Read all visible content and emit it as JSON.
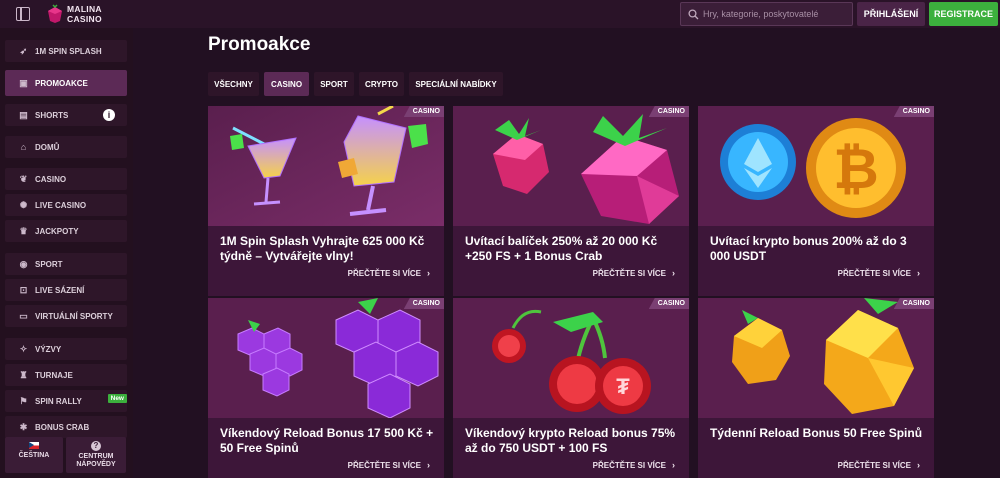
{
  "header": {
    "logo_line1": "MALINA",
    "logo_line2": "CASINO",
    "search_placeholder": "Hry, kategorie, poskytovatelé",
    "login_label": "PŘIHLÁŠENÍ",
    "register_label": "REGISTRACE"
  },
  "sidebar": {
    "items": [
      {
        "label": "1M SPIN SPLASH",
        "icon": "rocket-icon"
      },
      {
        "label": "PROMOAKCE",
        "icon": "gift-icon"
      },
      {
        "label": "SHORTS",
        "icon": "film-icon"
      },
      {
        "label": "DOMŮ",
        "icon": "home-icon"
      },
      {
        "label": "CASINO",
        "icon": "cherry-icon"
      },
      {
        "label": "LIVE CASINO",
        "icon": "chip-icon"
      },
      {
        "label": "JACKPOTY",
        "icon": "crown-icon"
      },
      {
        "label": "SPORT",
        "icon": "ball-icon"
      },
      {
        "label": "LIVE SÁZENÍ",
        "icon": "live-icon"
      },
      {
        "label": "VIRTUÁLNÍ SPORTY",
        "icon": "screen-icon"
      },
      {
        "label": "VÝZVY",
        "icon": "challenge-icon"
      },
      {
        "label": "TURNAJE",
        "icon": "trophy-icon"
      },
      {
        "label": "SPIN RALLY",
        "icon": "rally-icon"
      },
      {
        "label": "BONUS CRAB",
        "icon": "crab-icon"
      }
    ],
    "new_badge": "New",
    "language_label": "ČEŠTINA",
    "help_line1": "CENTRUM",
    "help_line2": "NÁPOVĚDY"
  },
  "main": {
    "title": "Promoakce",
    "tabs": [
      {
        "label": "VŠECHNY"
      },
      {
        "label": "CASINO",
        "active": true
      },
      {
        "label": "SPORT"
      },
      {
        "label": "CRYPTO"
      },
      {
        "label": "SPECIÁLNÍ NABÍDKY"
      }
    ],
    "read_more": "PŘEČTĚTE SI VÍCE",
    "cards": [
      {
        "badge": "CASINO",
        "title": "1M Spin Splash Vyhrajte 625 000 Kč týdně – Vytvářejte vlny!",
        "art": "cocktails"
      },
      {
        "badge": "CASINO",
        "title": "Uvítací balíček 250% až 20 000 Kč +250 FS + 1 Bonus Crab",
        "art": "raspberries"
      },
      {
        "badge": "CASINO",
        "title": "Uvítací krypto bonus 200% až do 3 000 USDT",
        "art": "crypto-coins"
      },
      {
        "badge": "CASINO",
        "title": "Víkendový Reload Bonus 17 500 Kč + 50 Free Spinů",
        "art": "grapes"
      },
      {
        "badge": "CASINO",
        "title": "Víkendový krypto Reload bonus 75% až do 750 USDT + 100 FS",
        "art": "cherries"
      },
      {
        "badge": "CASINO",
        "title": "Týdenní Reload Bonus 50 Free Spinů",
        "art": "lemons"
      }
    ]
  }
}
